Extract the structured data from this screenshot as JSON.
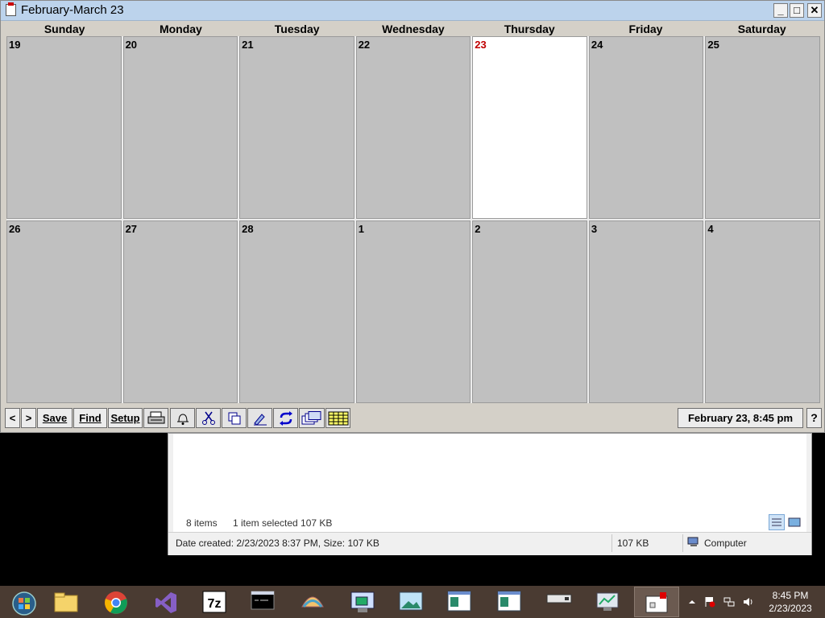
{
  "window": {
    "title": "February-March 23"
  },
  "calendar": {
    "days": [
      "Sunday",
      "Monday",
      "Tuesday",
      "Wednesday",
      "Thursday",
      "Friday",
      "Saturday"
    ],
    "weeks": [
      [
        "19",
        "20",
        "21",
        "22",
        "23",
        "24",
        "25"
      ],
      [
        "26",
        "27",
        "28",
        "1",
        "2",
        "3",
        "4"
      ]
    ],
    "today_label": "23"
  },
  "toolbar": {
    "prev_label": "<",
    "next_label": ">",
    "save_label": "Save",
    "find_label": "Find",
    "setup_label": "Setup",
    "icons": [
      "print-icon",
      "bell-icon",
      "scissors-icon",
      "copy-icon",
      "edit-icon",
      "repeat-icon",
      "windows-icon",
      "grid-icon"
    ],
    "datetime": "February 23, 8:45 pm",
    "help_label": "?"
  },
  "explorer": {
    "items_count": "8 items",
    "selected_info": "1 item selected  107 KB",
    "status_created": "Date created: 2/23/2023 8:37 PM, Size: 107 KB",
    "status_size": "107 KB",
    "status_location": "Computer"
  },
  "taskbar": {
    "apps": [
      "start-orb",
      "file-explorer",
      "chrome",
      "visual-studio",
      "7zip",
      "command-prompt",
      "shell-app",
      "ycdicas-app",
      "image-viewer",
      "window-app-1",
      "window-app-2",
      "device-app",
      "performance-app",
      "calendar-app"
    ],
    "time": "8:45 PM",
    "date": "2/23/2023"
  },
  "colors": {
    "today_number": "#c00000",
    "cell_bg": "#c0c0c0",
    "taskbar_bg": "#4a3b32"
  }
}
